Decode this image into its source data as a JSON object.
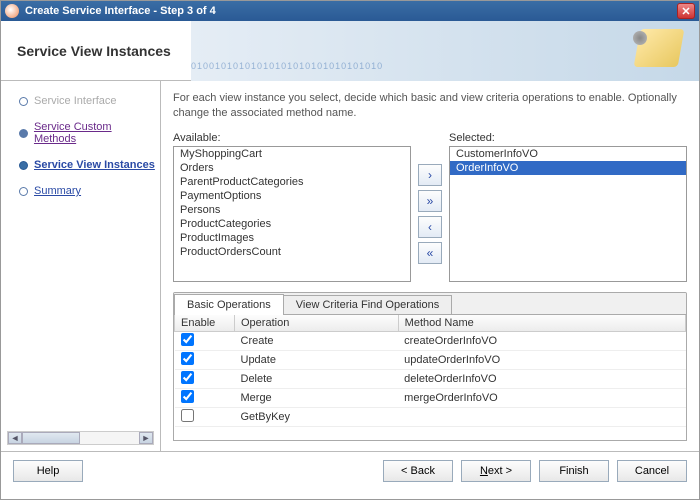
{
  "window": {
    "title": "Create Service Interface - Step 3 of 4"
  },
  "header": {
    "title": "Service View Instances"
  },
  "nav": {
    "items": [
      {
        "label": "Service Interface",
        "state": "disabled"
      },
      {
        "label": "Service Custom Methods",
        "state": "visited"
      },
      {
        "label": "Service View Instances",
        "state": "current"
      },
      {
        "label": "Summary",
        "state": "pending"
      }
    ]
  },
  "content": {
    "instructions": "For each view instance you select, decide which basic and view criteria operations to enable. Optionally change the associated method name.",
    "available_label": "Available:",
    "selected_label": "Selected:",
    "available": [
      "MyShoppingCart",
      "Orders",
      "ParentProductCategories",
      "PaymentOptions",
      "Persons",
      "ProductCategories",
      "ProductImages",
      "ProductOrdersCount"
    ],
    "selected": [
      {
        "label": "CustomerInfoVO",
        "selected": false
      },
      {
        "label": "OrderInfoVO",
        "selected": true
      }
    ],
    "tabs": {
      "basic": "Basic Operations",
      "criteria": "View Criteria Find Operations"
    },
    "ops_headers": {
      "enable": "Enable",
      "operation": "Operation",
      "method": "Method Name"
    },
    "ops": [
      {
        "enabled": true,
        "operation": "Create",
        "method": "createOrderInfoVO"
      },
      {
        "enabled": true,
        "operation": "Update",
        "method": "updateOrderInfoVO"
      },
      {
        "enabled": true,
        "operation": "Delete",
        "method": "deleteOrderInfoVO"
      },
      {
        "enabled": true,
        "operation": "Merge",
        "method": "mergeOrderInfoVO"
      },
      {
        "enabled": false,
        "operation": "GetByKey",
        "method": ""
      }
    ]
  },
  "footer": {
    "help": "Help",
    "back": "< Back",
    "next_prefix": "N",
    "next_suffix": "ext >",
    "finish": "Finish",
    "cancel": "Cancel"
  },
  "shuttle": {
    "add": "›",
    "addAll": "»",
    "remove": "‹",
    "removeAll": "«"
  }
}
